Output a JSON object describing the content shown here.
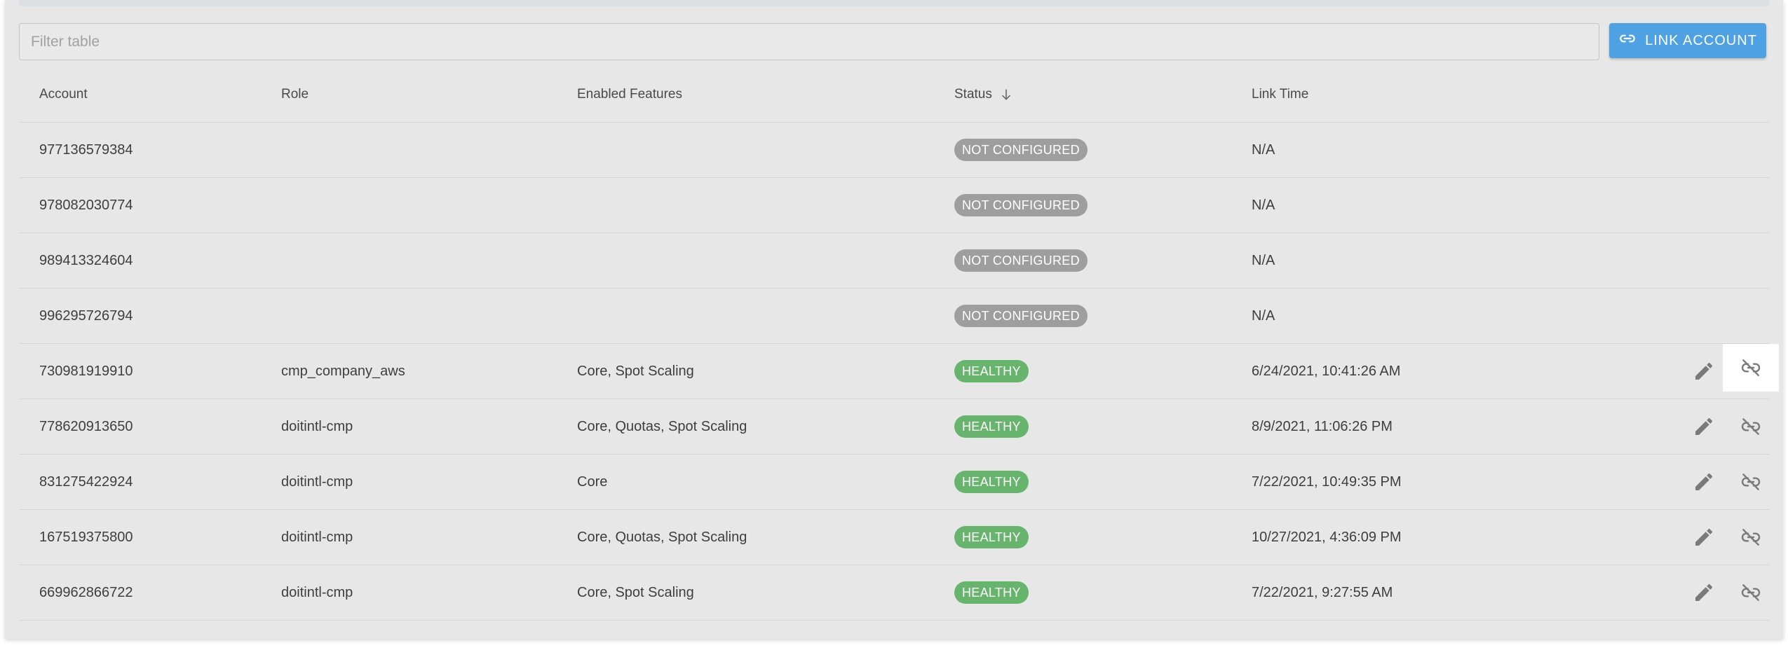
{
  "filter": {
    "placeholder": "Filter table"
  },
  "toolbar": {
    "link_account_label": "LINK ACCOUNT",
    "link_icon": "link-icon"
  },
  "columns": {
    "account": "Account",
    "role": "Role",
    "features": "Enabled Features",
    "status": "Status",
    "link_time": "Link Time"
  },
  "sort": {
    "column": "status",
    "direction": "descending",
    "icon": "arrow-down-icon"
  },
  "colors": {
    "not_configured": "#9e9e9e",
    "healthy": "#67b56d",
    "accent": "#4ea1e3"
  },
  "rows": [
    {
      "account": "977136579384",
      "role": "",
      "features": "",
      "status": "NOT CONFIGURED",
      "status_type": "gray",
      "link_time": "N/A",
      "actions": false
    },
    {
      "account": "978082030774",
      "role": "",
      "features": "",
      "status": "NOT CONFIGURED",
      "status_type": "gray",
      "link_time": "N/A",
      "actions": false
    },
    {
      "account": "989413324604",
      "role": "",
      "features": "",
      "status": "NOT CONFIGURED",
      "status_type": "gray",
      "link_time": "N/A",
      "actions": false
    },
    {
      "account": "996295726794",
      "role": "",
      "features": "",
      "status": "NOT CONFIGURED",
      "status_type": "gray",
      "link_time": "N/A",
      "actions": false
    },
    {
      "account": "730981919910",
      "role": "cmp_company_aws",
      "features": "Core, Spot Scaling",
      "status": "HEALTHY",
      "status_type": "green",
      "link_time": "6/24/2021, 10:41:26 AM",
      "actions": true,
      "hovered": true
    },
    {
      "account": "778620913650",
      "role": "doitintl-cmp",
      "features": "Core, Quotas, Spot Scaling",
      "status": "HEALTHY",
      "status_type": "green",
      "link_time": "8/9/2021, 11:06:26 PM",
      "actions": true
    },
    {
      "account": "831275422924",
      "role": "doitintl-cmp",
      "features": "Core",
      "status": "HEALTHY",
      "status_type": "green",
      "link_time": "7/22/2021, 10:49:35 PM",
      "actions": true
    },
    {
      "account": "167519375800",
      "role": "doitintl-cmp",
      "features": "Core, Quotas, Spot Scaling",
      "status": "HEALTHY",
      "status_type": "green",
      "link_time": "10/27/2021, 4:36:09 PM",
      "actions": true
    },
    {
      "account": "669962866722",
      "role": "doitintl-cmp",
      "features": "Core, Spot Scaling",
      "status": "HEALTHY",
      "status_type": "green",
      "link_time": "7/22/2021, 9:27:55 AM",
      "actions": true
    }
  ]
}
